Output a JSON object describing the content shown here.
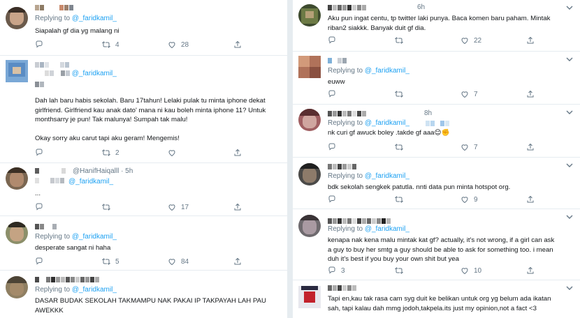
{
  "left": [
    {
      "reply_prefix": "Replying to ",
      "reply_to": "@_faridkamil_",
      "text": "Siapalah gf dia yg malang ni",
      "replies": "",
      "retweets": "4",
      "likes": "28"
    },
    {
      "reply_prefix": "",
      "reply_to": "@_faridkamil_",
      "text": "Dah lah baru habis sekolah. Baru 17tahun! Lelaki pulak tu minta iphone dekat girlfriend. Girlfriend kau anak dato' mana ni kau boleh minta iphone 11? Untuk monthsarry je pun! Tak malunya! Sumpah tak malu!\n\nOkay sorry aku carut tapi aku geram! Mengemis!",
      "replies": "",
      "retweets": "2",
      "likes": ""
    },
    {
      "handle": "@HanifHaiqalll · 5h",
      "reply_to": "@_faridkamil_",
      "text": "...",
      "replies": "",
      "retweets": "",
      "likes": "17"
    },
    {
      "reply_prefix": "Replying to ",
      "reply_to": "@_faridkamil_",
      "text": "desperate sangat ni haha",
      "replies": "",
      "retweets": "5",
      "likes": "84"
    },
    {
      "reply_prefix": "Replying to ",
      "reply_to": "@_faridkamil_",
      "text": "DASAR BUDAK SEKOLAH TAKMAMPU NAK PAKAI IP TAKPAYAH LAH PAU\nAWEKKK"
    }
  ],
  "right": [
    {
      "time": "6h",
      "text": "Aku pun ingat centu, tp twitter laki punya. Baca komen baru paham. Mintak\nriban2 siakkk. Banyak duit gf dia.",
      "replies": "",
      "retweets": "",
      "likes": "22"
    },
    {
      "reply_prefix": "Replying to ",
      "reply_to": "@_faridkamil_",
      "text": "euww",
      "replies": "",
      "retweets": "",
      "likes": "7"
    },
    {
      "time": "8h",
      "reply_prefix": "Replying to ",
      "reply_to": "@_faridkamil_",
      "text": "nk curi gf awuck boley .takde gf aaa😌✊",
      "replies": "",
      "retweets": "",
      "likes": "7"
    },
    {
      "reply_prefix": "Replying to ",
      "reply_to": "@_faridkamil_",
      "text": "bdk sekolah sengkek patutla. nnti data pun minta hotspot org.",
      "replies": "",
      "retweets": "",
      "likes": "9"
    },
    {
      "reply_prefix": "Replying to ",
      "reply_to": "@_faridkamil_",
      "text": "kenapa nak kena malu mintak kat gf? actually, it's not wrong, if a girl can ask\na guy to buy her smtg a guy should be able to ask for something too. i mean\nduh it's best if you buy your own shit but yea",
      "replies": "3",
      "retweets": "",
      "likes": "10"
    },
    {
      "text": "Tapi en,kau tak rasa cam syg duit ke belikan untuk org yg belum ada ikatan\nsah, tapi kalau dah mmg jodoh,takpela.its just my opinion,not a fact <3"
    }
  ],
  "colors": {
    "link": "#1da1f2",
    "muted": "#657786",
    "text": "#14171a",
    "separator": "#e6ecf0"
  },
  "icons": [
    "reply-icon",
    "retweet-icon",
    "like-icon",
    "share-icon",
    "chevron-down-icon"
  ]
}
